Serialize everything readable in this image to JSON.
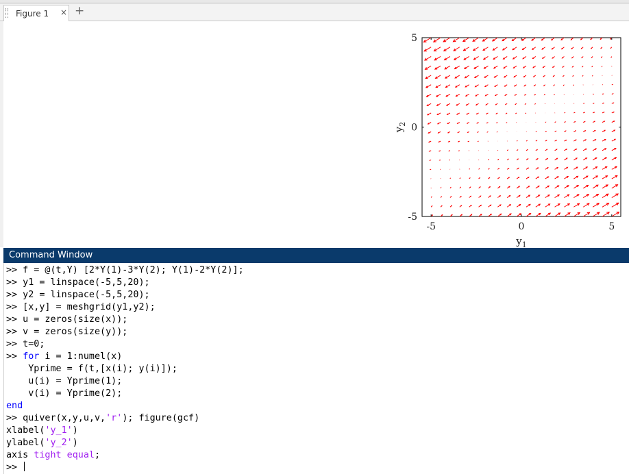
{
  "tabs": [
    {
      "label": "Figure 1"
    }
  ],
  "tab_close_glyph": "×",
  "tab_add_glyph": "+",
  "figure": {
    "xlabel": "y",
    "xlabel_sub": "1",
    "ylabel": "y",
    "ylabel_sub": "2",
    "arrow_color": "#ff0000",
    "chart_data": {
      "type": "quiver",
      "title": "",
      "xlim": [
        -5.5,
        5.5
      ],
      "ylim": [
        -5,
        5
      ],
      "xticks": [
        -5,
        0,
        5
      ],
      "yticks": [
        -5,
        0,
        5
      ],
      "grid": false,
      "x": {
        "linspace": [
          -5,
          5,
          20
        ]
      },
      "y": {
        "linspace": [
          -5,
          5,
          20
        ]
      },
      "u_expr": "2*y1-3*y2",
      "v_expr": "y1-2*y2"
    }
  },
  "command_window": {
    "title": "Command Window",
    "lines": [
      [
        {
          "t": ">> f = @(t,Y) [2*Y(1)-3*Y(2); Y(1)-2*Y(2)];",
          "c": ""
        }
      ],
      [
        {
          "t": ">> y1 = linspace(-5,5,20);",
          "c": ""
        }
      ],
      [
        {
          "t": ">> y2 = linspace(-5,5,20);",
          "c": ""
        }
      ],
      [
        {
          "t": ">> [x,y] = meshgrid(y1,y2);",
          "c": ""
        }
      ],
      [
        {
          "t": ">> u = zeros(size(x));",
          "c": ""
        }
      ],
      [
        {
          "t": ">> v = zeros(size(y));",
          "c": ""
        }
      ],
      [
        {
          "t": ">> t=0;",
          "c": ""
        }
      ],
      [
        {
          "t": ">> ",
          "c": ""
        },
        {
          "t": "for",
          "c": "kw"
        },
        {
          "t": " i = 1:numel(x)",
          "c": ""
        }
      ],
      [
        {
          "t": "    Yprime = f(t,[x(i); y(i)]);",
          "c": ""
        }
      ],
      [
        {
          "t": "    u(i) = Yprime(1);",
          "c": ""
        }
      ],
      [
        {
          "t": "    v(i) = Yprime(2);",
          "c": ""
        }
      ],
      [
        {
          "t": "end",
          "c": "kw"
        }
      ],
      [
        {
          "t": ">> quiver(x,y,u,v,",
          "c": ""
        },
        {
          "t": "'r'",
          "c": "str"
        },
        {
          "t": "); figure(gcf)",
          "c": ""
        }
      ],
      [
        {
          "t": "xlabel(",
          "c": ""
        },
        {
          "t": "'y_1'",
          "c": "str"
        },
        {
          "t": ")",
          "c": ""
        }
      ],
      [
        {
          "t": "ylabel(",
          "c": ""
        },
        {
          "t": "'y_2'",
          "c": "str"
        },
        {
          "t": ")",
          "c": ""
        }
      ],
      [
        {
          "t": "axis ",
          "c": ""
        },
        {
          "t": "tight equal",
          "c": "str"
        },
        {
          "t": ";",
          "c": ""
        }
      ]
    ],
    "prompt": ">> "
  }
}
